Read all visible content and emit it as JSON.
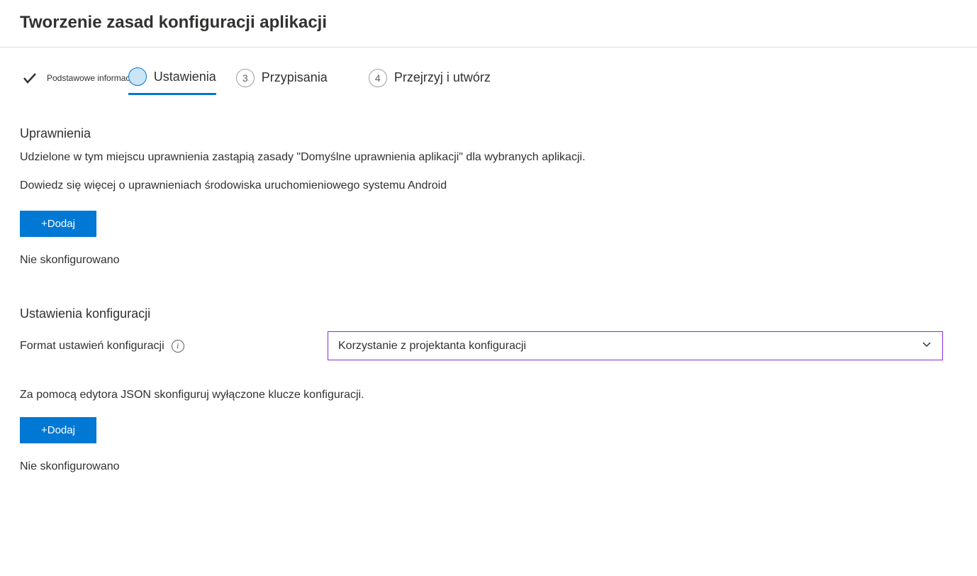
{
  "header": {
    "title": "Tworzenie zasad konfiguracji aplikacji"
  },
  "wizard": {
    "steps": [
      {
        "label": "Podstawowe informacje",
        "state": "completed"
      },
      {
        "label": "Ustawienia",
        "state": "active"
      },
      {
        "number": "3",
        "label": "Przypisania",
        "state": "pending"
      },
      {
        "number": "4",
        "label": "Przejrzyj i utwórz",
        "state": "pending"
      }
    ]
  },
  "permissions": {
    "title": "Uprawnienia",
    "description": "Udzielone w tym miejscu uprawnienia zastąpią zasady \"Domyślne uprawnienia aplikacji\" dla wybranych aplikacji.",
    "learn_more": "Dowiedz się więcej o uprawnieniach środowiska uruchomieniowego systemu Android",
    "add_button": "+Dodaj",
    "status": "Nie skonfigurowano"
  },
  "config": {
    "title": "Ustawienia konfiguracji",
    "format_label": "Format ustawień konfiguracji",
    "format_value": "Korzystanie z projektanta konfiguracji",
    "json_desc": "Za pomocą edytora JSON skonfiguruj wyłączone klucze konfiguracji.",
    "add_button": "+Dodaj",
    "status": "Nie skonfigurowano"
  }
}
